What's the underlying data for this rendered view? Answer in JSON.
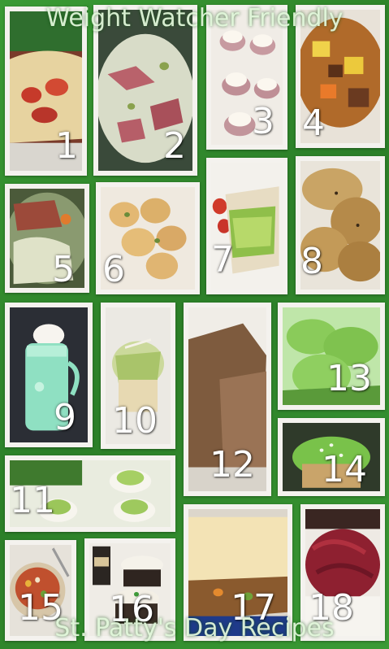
{
  "header": {
    "title": "Weight Watcher Friendly"
  },
  "footer": {
    "subtitle": "St. Patty's Day Recipes"
  },
  "tiles": [
    {
      "number": "1",
      "subject": "cheese-pastry"
    },
    {
      "number": "2",
      "subject": "corned-beef-coleslaw"
    },
    {
      "number": "3",
      "subject": "stuffed-potato-bites"
    },
    {
      "number": "4",
      "subject": "irish-stew"
    },
    {
      "number": "5",
      "subject": "corned-beef-cabbage"
    },
    {
      "number": "6",
      "subject": "cheddar-biscuits"
    },
    {
      "number": "7",
      "subject": "veggie-wrap"
    },
    {
      "number": "8",
      "subject": "potato-cakes"
    },
    {
      "number": "9",
      "subject": "green-shake"
    },
    {
      "number": "10",
      "subject": "cabbage-salad"
    },
    {
      "number": "12",
      "subject": "soda-bread"
    },
    {
      "number": "13",
      "subject": "green-cookies"
    },
    {
      "number": "14",
      "subject": "green-cupcake"
    },
    {
      "number": "11",
      "subject": "guacamole-deviled-eggs"
    },
    {
      "number": "15",
      "subject": "soup"
    },
    {
      "number": "16",
      "subject": "guinness-cupcakes"
    },
    {
      "number": "17",
      "subject": "shepherds-pie"
    },
    {
      "number": "18",
      "subject": "braised-red-cabbage"
    }
  ]
}
